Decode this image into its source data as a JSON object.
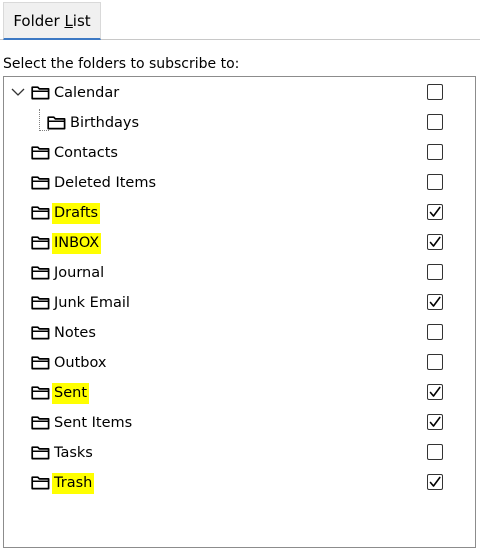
{
  "tabs": [
    {
      "label_pre": "Folder ",
      "label_underlined": "L",
      "label_post": "ist"
    }
  ],
  "instruction": "Select the folders to subscribe to:",
  "folders": [
    {
      "name": "Calendar",
      "checked": false,
      "highlighted": false,
      "level": 0,
      "expanded": true
    },
    {
      "name": "Birthdays",
      "checked": false,
      "highlighted": false,
      "level": 1
    },
    {
      "name": "Contacts",
      "checked": false,
      "highlighted": false,
      "level": 0
    },
    {
      "name": "Deleted Items",
      "checked": false,
      "highlighted": false,
      "level": 0
    },
    {
      "name": "Drafts",
      "checked": true,
      "highlighted": true,
      "level": 0
    },
    {
      "name": "INBOX",
      "checked": true,
      "highlighted": true,
      "level": 0
    },
    {
      "name": "Journal",
      "checked": false,
      "highlighted": false,
      "level": 0
    },
    {
      "name": "Junk Email",
      "checked": true,
      "highlighted": false,
      "level": 0
    },
    {
      "name": "Notes",
      "checked": false,
      "highlighted": false,
      "level": 0
    },
    {
      "name": "Outbox",
      "checked": false,
      "highlighted": false,
      "level": 0
    },
    {
      "name": "Sent",
      "checked": true,
      "highlighted": true,
      "level": 0
    },
    {
      "name": "Sent Items",
      "checked": true,
      "highlighted": false,
      "level": 0
    },
    {
      "name": "Tasks",
      "checked": false,
      "highlighted": false,
      "level": 0
    },
    {
      "name": "Trash",
      "checked": true,
      "highlighted": true,
      "level": 0
    }
  ],
  "colors": {
    "highlight": "#ffff00",
    "tab_accent": "#3c78c3",
    "tab_background": "#f0f0f0"
  },
  "icons": {
    "folder": "folder-icon",
    "expand": "chevron-down-icon",
    "checkmark": "checkmark-icon"
  }
}
